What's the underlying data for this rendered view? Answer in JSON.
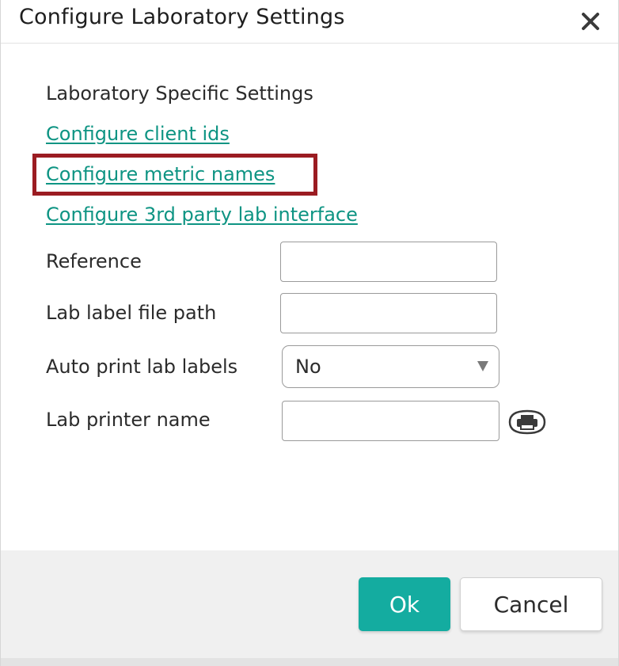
{
  "dialog": {
    "title": "Configure Laboratory Settings",
    "close_icon": "close-icon"
  },
  "section": {
    "heading": "Laboratory Specific Settings"
  },
  "links": {
    "client_ids": "Configure client ids",
    "metric_names": "Configure metric names",
    "third_party": "Configure 3rd party lab interface"
  },
  "form": {
    "reference_label": "Reference",
    "reference_value": "",
    "lab_label_path_label": "Lab label file path",
    "lab_label_path_value": "",
    "auto_print_label": "Auto print lab labels",
    "auto_print_value": "No",
    "printer_name_label": "Lab printer name",
    "printer_name_value": "",
    "printer_icon": "printer-icon"
  },
  "footer": {
    "ok_label": "Ok",
    "cancel_label": "Cancel"
  },
  "colors": {
    "link": "#0e9483",
    "highlight": "#9b1c22",
    "ok_button": "#14aca0",
    "footer_bg": "#f0f0f0"
  }
}
